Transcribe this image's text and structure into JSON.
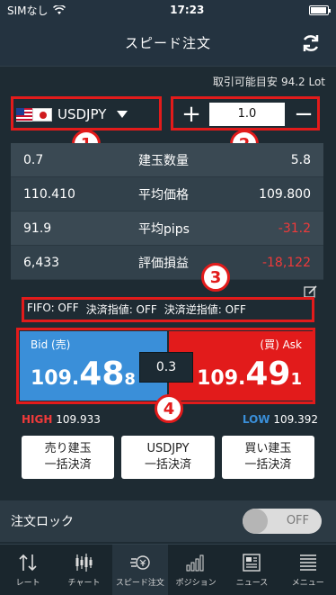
{
  "status": {
    "carrier": "SIMなし",
    "time": "17:23"
  },
  "header": {
    "title": "スピード注文"
  },
  "available": {
    "label": "取引可能目安",
    "value": "94.2 Lot"
  },
  "currency": {
    "pair": "USDJPY"
  },
  "quantity": {
    "value": "1.0",
    "plus": "+",
    "minus": "−"
  },
  "badges": [
    "1",
    "2",
    "3",
    "4"
  ],
  "stats": [
    {
      "left": "0.7",
      "label": "建玉数量",
      "right": "5.8"
    },
    {
      "left": "110.410",
      "label": "平均価格",
      "right": "109.800"
    },
    {
      "left": "91.9",
      "label": "平均pips",
      "right": "-31.2"
    },
    {
      "left": "6,433",
      "label": "評価損益",
      "right": "-18,122"
    }
  ],
  "fifo": {
    "fifo": "FIFO: OFF",
    "limit": "決済指値: OFF",
    "stop": "決済逆指値: OFF"
  },
  "bid": {
    "label": "Bid (売)",
    "p1": "109.",
    "p2": "48",
    "p3": "8"
  },
  "ask": {
    "label": "(買) Ask",
    "p1": "109.",
    "p2": "49",
    "p3": "1"
  },
  "spread": "0.3",
  "high": {
    "label": "HIGH",
    "value": "109.933"
  },
  "low": {
    "label": "LOW",
    "value": "109.392"
  },
  "actions": [
    {
      "line1": "売り建玉",
      "line2": "一括決済"
    },
    {
      "line1": "USDJPY",
      "line2": "一括決済"
    },
    {
      "line1": "買い建玉",
      "line2": "一括決済"
    }
  ],
  "lock": {
    "label": "注文ロック",
    "toggle": "OFF"
  },
  "tabs": [
    {
      "label": "レート",
      "icon": "rate-icon"
    },
    {
      "label": "チャート",
      "icon": "chart-icon"
    },
    {
      "label": "スピード注文",
      "icon": "speed-order-icon"
    },
    {
      "label": "ポジション",
      "icon": "position-icon"
    },
    {
      "label": "ニュース",
      "icon": "news-icon"
    },
    {
      "label": "メニュー",
      "icon": "menu-icon"
    }
  ],
  "colors": {
    "bid": "#3a8fd9",
    "ask": "#e21b1b",
    "negative": "#f03a3a",
    "annotation": "#e21b1b"
  }
}
